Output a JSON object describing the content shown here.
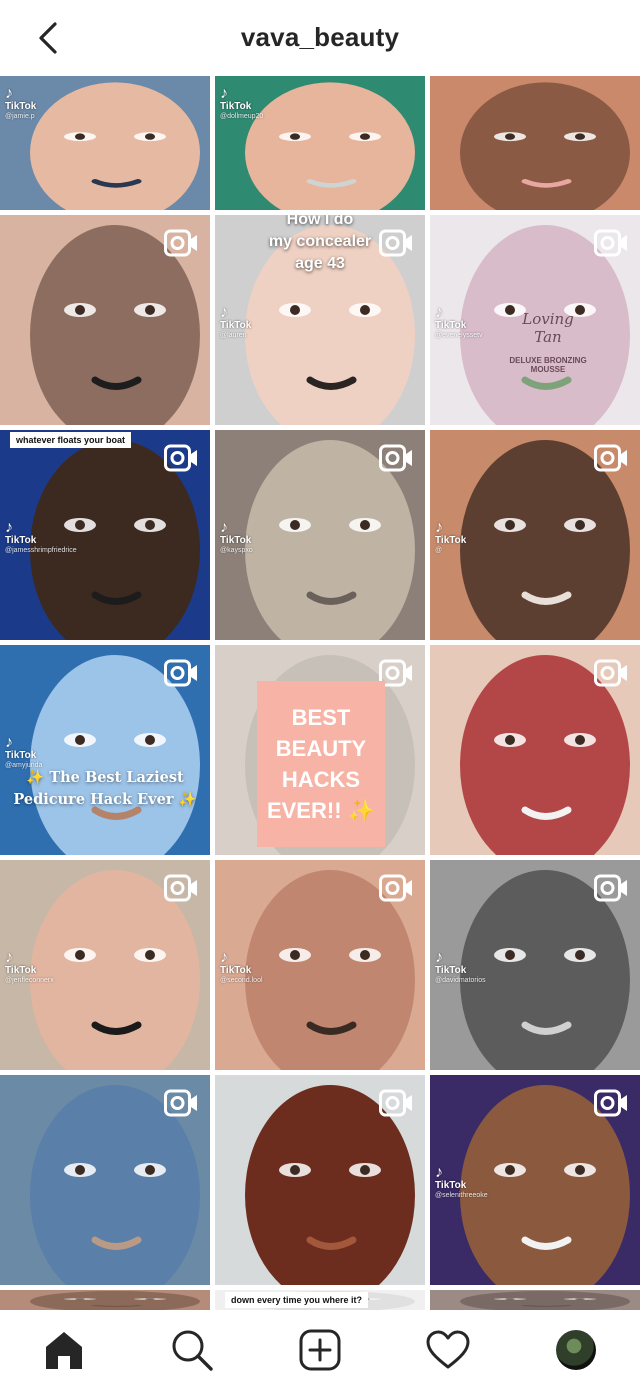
{
  "header": {
    "title": "vava_beauty"
  },
  "tiles": [
    {
      "id": 1,
      "tiktok_handle": "@jamie.p",
      "reel": false,
      "colors": [
        "#6b89a8",
        "#e6b9a2",
        "#2a3750"
      ]
    },
    {
      "id": 2,
      "tiktok_handle": "@dollmeup20",
      "reel": false,
      "colors": [
        "#2f8a72",
        "#e7b49c",
        "#cfd4d3"
      ]
    },
    {
      "id": 3,
      "tiktok_handle": "",
      "reel": false,
      "colors": [
        "#c9896a",
        "#8a5a44",
        "#e9a7a2"
      ]
    },
    {
      "id": 4,
      "tiktok_handle": "",
      "reel": true,
      "colors": [
        "#d8b3a2",
        "#8c6d5f",
        "#1d1d1d"
      ]
    },
    {
      "id": 5,
      "tiktok_handle": "@lauren",
      "reel": true,
      "overlay": [
        "How I do",
        "my concealer",
        "age 43"
      ],
      "colors": [
        "#cfcfcf",
        "#efd1c3",
        "#2a2522"
      ]
    },
    {
      "id": 6,
      "tiktok_handle": "@evenelyssetv",
      "reel": true,
      "product": {
        "brand": "Loving Tan",
        "name": "DELUXE BRONZING",
        "sub": "MOUSSE"
      },
      "colors": [
        "#ece7ea",
        "#d9bcc9",
        "#7ea37a"
      ]
    },
    {
      "id": 7,
      "tiktok_handle": "@jamesshrimpfriedrice",
      "reel": true,
      "caption": "whatever floats your boat",
      "colors": [
        "#1b3b8a",
        "#3c2a21",
        "#1c1c1c"
      ]
    },
    {
      "id": 8,
      "tiktok_handle": "@kayspxo",
      "reel": true,
      "colors": [
        "#8d8078",
        "#bfb3a3",
        "#6b615b"
      ]
    },
    {
      "id": 9,
      "tiktok_handle": "@",
      "reel": true,
      "colors": [
        "#c78a6a",
        "#5d3f31",
        "#e8e0d8"
      ]
    },
    {
      "id": 10,
      "tiktok_handle": "@amyjunda",
      "reel": true,
      "caption_lines": [
        "✨ The Best Laziest",
        "Pedicure Hack Ever ✨"
      ],
      "colors": [
        "#2f6fb0",
        "#9cc3e8",
        "#b5826a"
      ]
    },
    {
      "id": 11,
      "tiktok_handle": "",
      "reel": true,
      "overlay_lines": [
        "BEST",
        "BEAUTY",
        "HACKS",
        "EVER!! ✨"
      ],
      "colors": [
        "#d8d0c8",
        "#c6c0b8",
        "#3e5fa8"
      ]
    },
    {
      "id": 12,
      "tiktok_handle": "",
      "reel": true,
      "colors": [
        "#e6c9b9",
        "#b34748",
        "#f2f2f2"
      ]
    },
    {
      "id": 13,
      "tiktok_handle": "@jenfleconnerx",
      "reel": true,
      "colors": [
        "#c7b7a7",
        "#e2b5a0",
        "#1a1a1a"
      ]
    },
    {
      "id": 14,
      "tiktok_handle": "@second.lool",
      "reel": true,
      "colors": [
        "#d9a992",
        "#c08670",
        "#3a2a24"
      ]
    },
    {
      "id": 15,
      "tiktok_handle": "@davidmatorios",
      "reel": true,
      "colors": [
        "#9a9a9a",
        "#5c5c5c",
        "#d0d0d0"
      ]
    },
    {
      "id": 16,
      "tiktok_handle": "",
      "reel": true,
      "colors": [
        "#6b8aa6",
        "#5a7fa9",
        "#b89a86"
      ]
    },
    {
      "id": 17,
      "tiktok_handle": "",
      "reel": true,
      "colors": [
        "#d7dada",
        "#6c2d1e",
        "#a3583c"
      ]
    },
    {
      "id": 18,
      "tiktok_handle": "@selenithreeoke",
      "reel": true,
      "colors": [
        "#3a2a66",
        "#8b5a3e",
        "#f2f2f2"
      ]
    },
    {
      "id": 19,
      "tiktok_handle": "",
      "reel": false,
      "colors": [
        "#b58b7a",
        "#8c6a5a",
        "#6a4b3c"
      ]
    },
    {
      "id": 20,
      "tiktok_handle": "",
      "reel": false,
      "caption": "down every time you where it?",
      "colors": [
        "#f0f0f0",
        "#e0e0e0",
        "#cccccc"
      ]
    },
    {
      "id": 21,
      "tiktok_handle": "",
      "reel": false,
      "colors": [
        "#9c8a85",
        "#7a6a66",
        "#5c4d4a"
      ]
    }
  ],
  "tabs": [
    {
      "name": "home"
    },
    {
      "name": "search"
    },
    {
      "name": "new-post"
    },
    {
      "name": "activity"
    },
    {
      "name": "profile"
    }
  ],
  "tiktok_label": "TikTok"
}
